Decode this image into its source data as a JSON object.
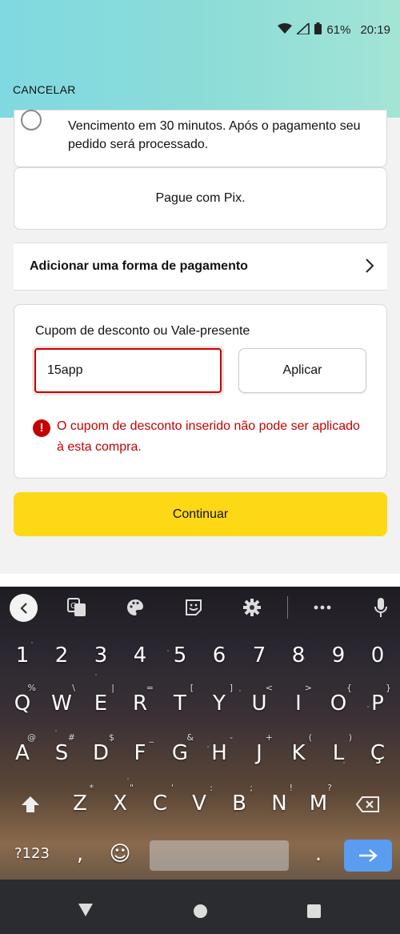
{
  "status": {
    "battery": "61%",
    "time": "20:19"
  },
  "header": {
    "cancel_label": "CANCELAR"
  },
  "payment_option": {
    "description": "Vencimento em 30 minutos. Após o pagamento seu pedido será processado."
  },
  "pix": {
    "label": "Pague com Pix."
  },
  "add_payment": {
    "label": "Adicionar uma forma de pagamento"
  },
  "coupon": {
    "label": "Cupom de desconto ou Vale-presente",
    "value": "15app",
    "apply_label": "Aplicar",
    "error_icon": "!",
    "error_text": "O cupom de desconto inserido não pode ser aplicado à esta compra."
  },
  "continue_label": "Continuar",
  "keyboard": {
    "row_numbers": [
      "1",
      "2",
      "3",
      "4",
      "5",
      "6",
      "7",
      "8",
      "9",
      "0"
    ],
    "row1": [
      {
        "k": "Q",
        "h": "%"
      },
      {
        "k": "W",
        "h": "\\"
      },
      {
        "k": "E",
        "h": "|"
      },
      {
        "k": "R",
        "h": "="
      },
      {
        "k": "T",
        "h": "["
      },
      {
        "k": "Y",
        "h": "]"
      },
      {
        "k": "U",
        "h": "<"
      },
      {
        "k": "I",
        "h": ">"
      },
      {
        "k": "O",
        "h": "{"
      },
      {
        "k": "P",
        "h": "}"
      }
    ],
    "row2": [
      {
        "k": "A",
        "h": "@"
      },
      {
        "k": "S",
        "h": "#"
      },
      {
        "k": "D",
        "h": "$"
      },
      {
        "k": "F",
        "h": "_"
      },
      {
        "k": "G",
        "h": "&"
      },
      {
        "k": "H",
        "h": "-"
      },
      {
        "k": "J",
        "h": "+"
      },
      {
        "k": "K",
        "h": "("
      },
      {
        "k": "L",
        "h": ")"
      },
      {
        "k": "Ç",
        "h": ""
      }
    ],
    "row3": [
      {
        "k": "Z",
        "h": "*"
      },
      {
        "k": "X",
        "h": "\""
      },
      {
        "k": "C",
        "h": "'"
      },
      {
        "k": "V",
        "h": ":"
      },
      {
        "k": "B",
        "h": ";"
      },
      {
        "k": "N",
        "h": "!"
      },
      {
        "k": "M",
        "h": "?"
      }
    ],
    "symbols_label": "?123",
    "comma": ",",
    "period": ".",
    "emoji_icon": "☺"
  },
  "colors": {
    "accent_yellow": "#fdd815",
    "error_red": "#c40000",
    "enter_blue": "#5a9cf0"
  }
}
